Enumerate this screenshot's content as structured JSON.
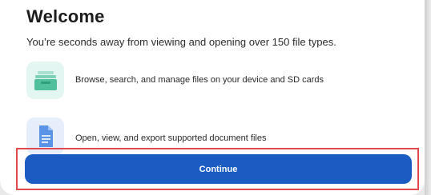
{
  "welcome": {
    "title": "Welcome",
    "subtitle": "You’re seconds away from viewing and opening over 150 file types."
  },
  "features": [
    {
      "icon": "folder-stack-icon",
      "label": "Browse, search, and manage files on your device and SD cards"
    },
    {
      "icon": "document-icon",
      "label": "Open, view, and export supported document files"
    }
  ],
  "actions": {
    "continue_label": "Continue"
  },
  "colors": {
    "primary": "#1a5cc2",
    "highlight": "#e0494e",
    "feature_green_bg": "#e3f6f1",
    "feature_blue_bg": "#e6eefb"
  }
}
